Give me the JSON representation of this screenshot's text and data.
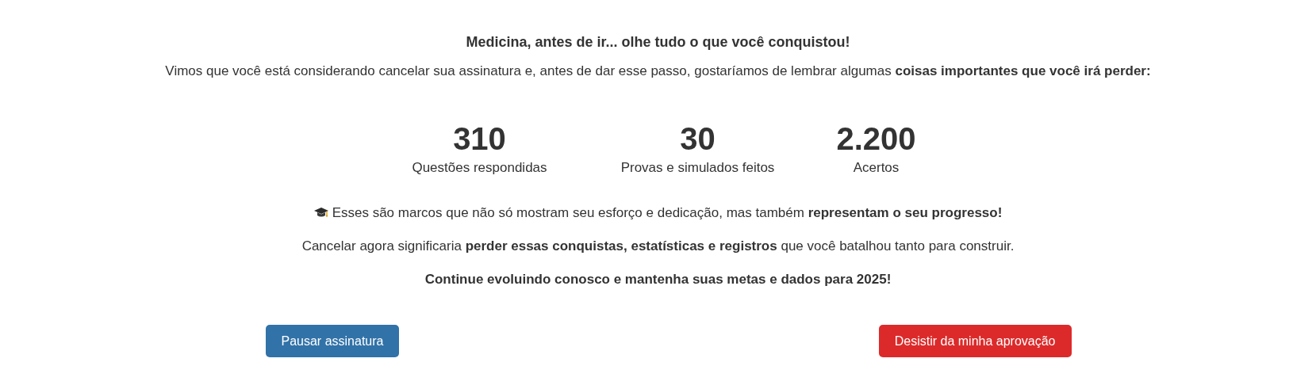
{
  "title": "Medicina, antes de ir... olhe tudo o que você conquistou!",
  "intro": "Vimos que você está considerando cancelar sua assinatura e, antes de dar esse passo, gostaríamos de lembrar algumas **coisas importantes que você irá perder:**",
  "stats": [
    {
      "value": "310",
      "label": "Questões respondidas"
    },
    {
      "value": "30",
      "label": "Provas e simulados feitos"
    },
    {
      "value": "2.200",
      "label": "Acertos"
    }
  ],
  "messages": [
    {
      "kind": "icon",
      "text": "Esses são marcos que não só mostram seu esforço e dedicação, mas também **representam o seu progresso!**"
    },
    {
      "kind": "plain",
      "text": "Cancelar agora significaria **perder essas conquistas, estatísticas e registros** que você batalhou tanto para construir."
    },
    {
      "kind": "bold",
      "text": "Continue evoluindo conosco e mantenha suas metas e dados para 2025!"
    }
  ],
  "buttons": [
    {
      "label": "Pausar assinatura",
      "kind": "primary"
    },
    {
      "label": "Desistir da minha aprovação",
      "kind": "danger"
    }
  ]
}
